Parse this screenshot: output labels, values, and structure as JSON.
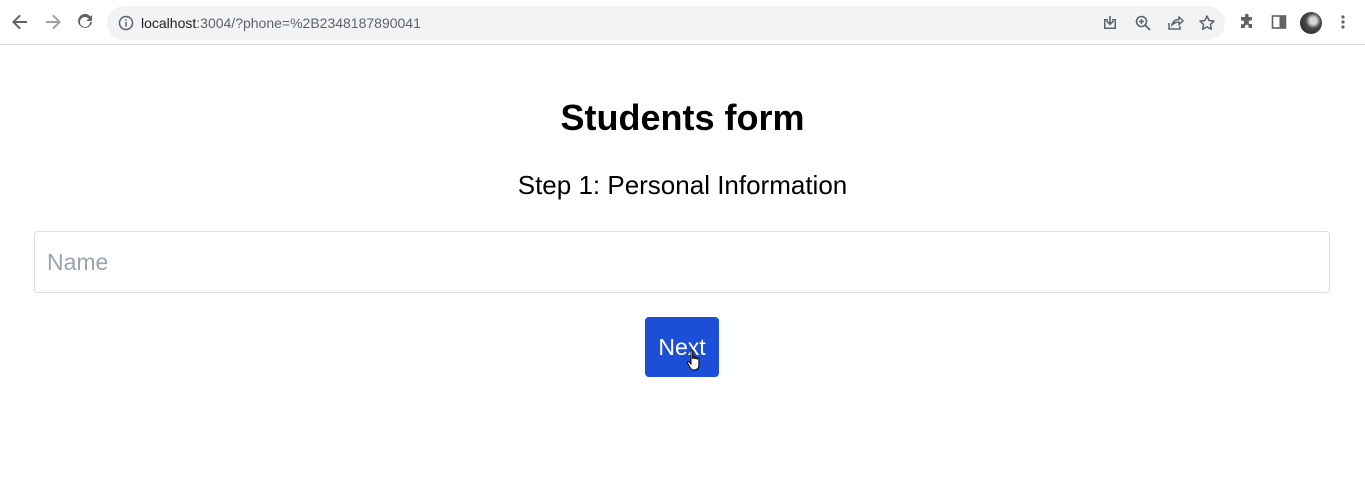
{
  "browser": {
    "url_host": "localhost",
    "url_rest": ":3004/?phone=%2B2348187890041",
    "icons": {
      "back": "back-arrow-icon",
      "forward": "forward-arrow-icon",
      "reload": "reload-icon",
      "site_info": "info-icon",
      "install": "install-app-icon",
      "zoom": "zoom-icon",
      "share": "share-icon",
      "bookmark": "star-icon",
      "extensions": "puzzle-icon",
      "side_panel": "side-panel-icon",
      "profile": "avatar",
      "menu": "kebab-menu-icon"
    }
  },
  "form": {
    "title": "Students form",
    "step_title": "Step 1: Personal Information",
    "name_placeholder": "Name",
    "name_value": "",
    "next_label": "Next"
  },
  "colors": {
    "primary_button": "#1d4ed8",
    "placeholder": "#9ca3af",
    "omnibox_bg": "#f1f3f4"
  }
}
